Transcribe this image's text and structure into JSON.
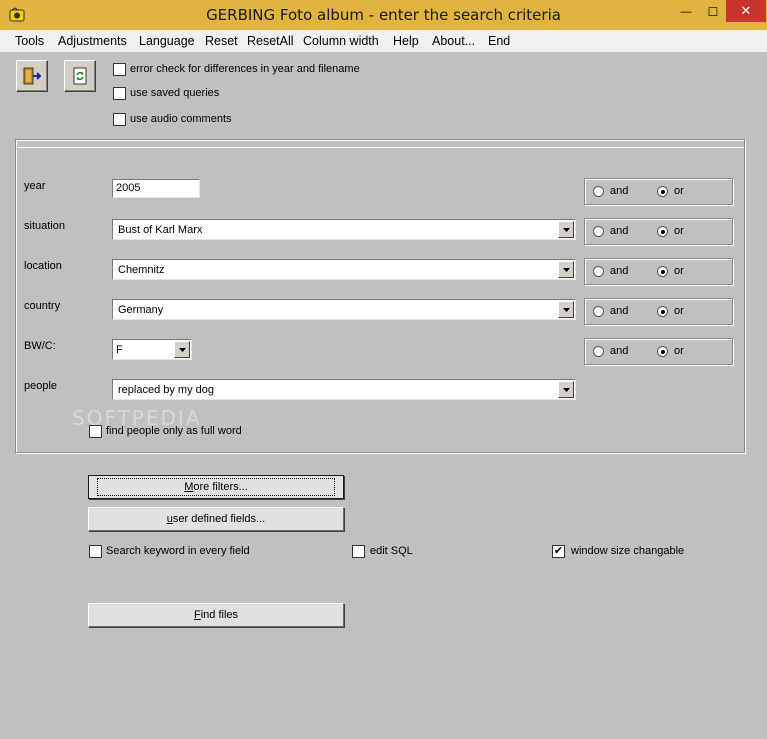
{
  "window": {
    "title": "GERBING Foto album - enter the search criteria",
    "minimize_glyph": "—",
    "maximize_glyph": "☐",
    "close_glyph": "✕"
  },
  "menu": [
    "Tools",
    "Adjustments",
    "Language",
    "Reset",
    "ResetAll",
    "Column width",
    "Help",
    "About...",
    "End"
  ],
  "options": {
    "error_check": {
      "label": "error check for differences in year and filename",
      "checked": false
    },
    "saved_queries": {
      "label": "use saved queries",
      "checked": false
    },
    "audio_comments": {
      "label": "use audio comments",
      "checked": false
    }
  },
  "fields": {
    "year": {
      "label": "year",
      "value": "2005"
    },
    "situation": {
      "label": "situation",
      "value": "Bust of Karl Marx"
    },
    "location": {
      "label": "location",
      "value": "Chemnitz"
    },
    "country": {
      "label": "country",
      "value": "Germany"
    },
    "bwc": {
      "label": "BW/C:",
      "value": "F"
    },
    "people": {
      "label": "people",
      "value": "replaced by my dog"
    }
  },
  "logic": {
    "and_label": "and",
    "or_label": "or",
    "selected": "or"
  },
  "people_fullword": {
    "label": "find people only as full word",
    "checked": false
  },
  "buttons": {
    "more_filters_underline": "M",
    "more_filters_rest": "ore filters...",
    "user_fields_underline": "u",
    "user_fields_rest": "ser defined fields...",
    "find_underline": "F",
    "find_rest": "ind files"
  },
  "bottom_options": {
    "search_every_field": {
      "label": "Search keyword in every field",
      "checked": false
    },
    "edit_sql": {
      "label": "edit SQL",
      "checked": false
    },
    "window_size": {
      "label": "window size changable",
      "checked": true,
      "glyph": "✔"
    }
  },
  "watermark": "SOFTPEDIA"
}
